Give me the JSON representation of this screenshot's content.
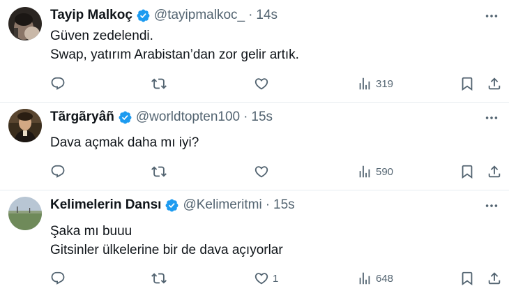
{
  "tweets": [
    {
      "name": "Tayip Malkoç",
      "handle": "@tayipmalkoc_",
      "separator": "·",
      "time": "14s",
      "lines": [
        "Güven zedelendi.",
        "Swap, yatırım Arabistan’dan zor gelir artık."
      ],
      "replies": "",
      "retweets": "",
      "likes": "",
      "views": "319"
    },
    {
      "name": "Tãrgãryâñ",
      "handle": "@worldtopten100",
      "separator": "·",
      "time": "15s",
      "lines": [
        "Dava açmak daha mı iyi?"
      ],
      "replies": "",
      "retweets": "",
      "likes": "",
      "views": "590"
    },
    {
      "name": "Kelimelerin Dansı",
      "handle": "@Kelimeritmi",
      "separator": "·",
      "time": "15s",
      "lines": [
        "Şaka mı buuu",
        "Gitsinler ülkelerine bir de dava açıyorlar"
      ],
      "replies": "",
      "retweets": "",
      "likes": "1",
      "views": "648"
    }
  ],
  "icons": {
    "reply": "reply-icon",
    "retweet": "retweet-icon",
    "like": "heart-icon",
    "views": "views-icon",
    "bookmark": "bookmark-icon",
    "share": "share-icon",
    "more": "more-icon",
    "verified": "verified-badge-icon"
  },
  "colors": {
    "text": "#0f1419",
    "secondary": "#536471",
    "verified": "#1d9bf0",
    "divider": "#e6ecf0"
  }
}
